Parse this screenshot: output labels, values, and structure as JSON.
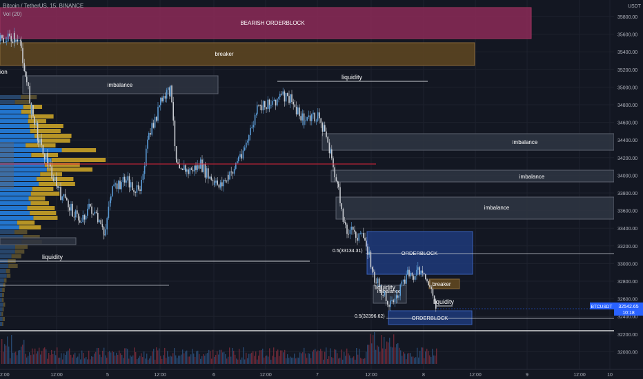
{
  "header": {
    "title": "Bitcoin / TetherUS, 15, BINANCE",
    "volume_label": "Vol (20)"
  },
  "currency": "USDT",
  "price_axis": {
    "labels": [
      "35800.00",
      "35600.00",
      "35400.00",
      "35200.00",
      "35000.00",
      "34800.00",
      "34600.00",
      "34400.00",
      "34200.00",
      "34000.00",
      "33800.00",
      "33600.00",
      "33400.00",
      "33200.00",
      "33000.00",
      "32800.00",
      "32600.00",
      "32400.00",
      "32200.00",
      "32000.00"
    ]
  },
  "time_axis": {
    "labels": [
      "12:00",
      "5",
      "12:00",
      "6",
      "12:00",
      "7",
      "12:00",
      "8",
      "12:00",
      "9",
      "12:00",
      "10"
    ],
    "first_label_fragment": "2:00"
  },
  "cropped_left_text": "ion",
  "current_price": {
    "symbol": "BTCUSDT",
    "price": "32542.65",
    "countdown": "10:18",
    "color": "#2962ff"
  },
  "zones": {
    "bearish_orderblock": "BEARISH ORDERBLOCK",
    "breaker_top": "breaker",
    "imbalance_left": "imbalance",
    "imbalance_right_1": "imbalance",
    "imbalance_right_2": "imbalance",
    "imbalance_right_3": "imbalance",
    "orderblock_upper": "ORDERBLOCK",
    "orderblock_lower": "ORDERBLOCK",
    "breaker_small": "breaker",
    "imbalance_small": "imbalance"
  },
  "annotations": {
    "liquidity_top": "liquidity",
    "liquidity_left": "liquidity",
    "liquidity_mid": "liquidity",
    "liquidity_right": "liquidity",
    "fib_upper": "0.5(33134.31)",
    "fib_lower": "0.5(32396.62)"
  },
  "colors": {
    "background": "#131722",
    "bull_candle": "#5b9bd5",
    "bear_candle": "#c9ccd2",
    "bearish_ob": "#8c2a57",
    "breaker": "#5c4521",
    "imbalance": "#2e3441",
    "orderblock": "#1e3a7a",
    "poc_line": "#e0243a",
    "vp_blue": "#2680e0",
    "vp_yellow": "#c9a227"
  }
}
